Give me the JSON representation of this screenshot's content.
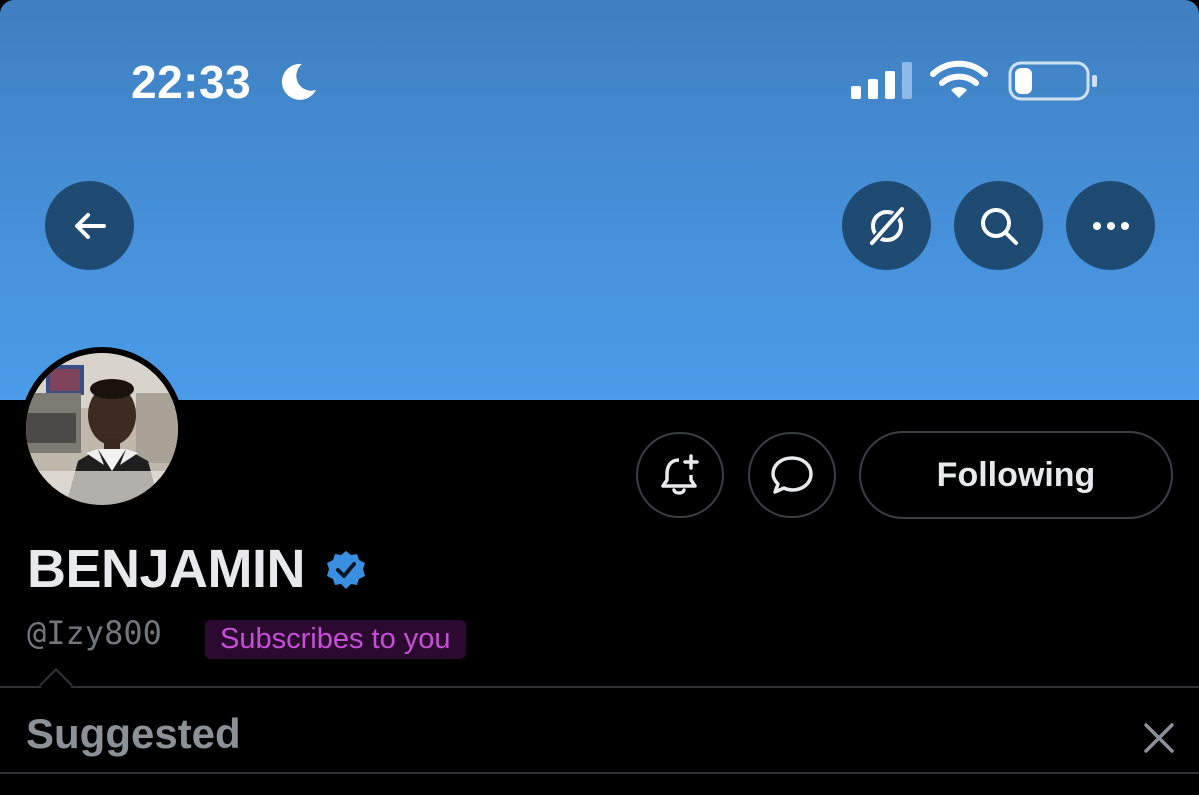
{
  "status_bar": {
    "time": "22:33",
    "moon_icon": "moon-icon",
    "signal_icon": "cellular-signal-icon",
    "wifi_icon": "wifi-icon",
    "battery_icon": "battery-icon",
    "battery_level": 0.25
  },
  "header": {
    "banner_color": "#4690d9",
    "back_icon": "arrow-left-icon",
    "grok_icon": "grok-icon",
    "search_icon": "search-icon",
    "more_icon": "more-horizontal-icon"
  },
  "profile": {
    "display_name": "BENJAMIN",
    "verified_icon": "verified-badge-icon",
    "verified_color": "#3b8fe0",
    "handle": "@Izy800",
    "subscribes_badge": "Subscribes to you",
    "badge_color": "#c64fd8"
  },
  "actions": {
    "notify_icon": "bell-plus-icon",
    "message_icon": "message-bubble-icon",
    "following_label": "Following"
  },
  "suggested": {
    "title": "Suggested",
    "close_icon": "close-icon"
  }
}
